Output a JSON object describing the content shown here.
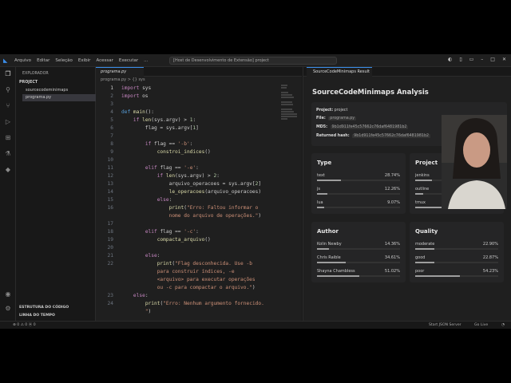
{
  "titlebar": {
    "menus": [
      "Arquivo",
      "Editar",
      "Seleção",
      "Exibir",
      "Acessar",
      "Executar",
      "..."
    ],
    "command_center": "[Host de Desenvolvimento de Extensão] project"
  },
  "sidebar": {
    "title": "EXPLORADOR",
    "section": "PROJECT",
    "files": [
      {
        "name": "sourcecodeminimaps"
      },
      {
        "name": "programa.py"
      }
    ],
    "bottom_sections": [
      "ESTRUTURA DO CÓDIGO",
      "LINHA DO TEMPO"
    ]
  },
  "editor": {
    "tab_label": "programa.py",
    "breadcrumb": "programa.py > {} sys"
  },
  "panel": {
    "tab_label": "SourceCodeMinimaps Result",
    "title": "SourceCodeMinimaps Analysis",
    "info": {
      "project_label": "Project:",
      "project": "project",
      "file_label": "File:",
      "file": "programa.py",
      "md5_label": "MD5:",
      "md5": "9b1d911fe45c57662c76daf6481981b2",
      "returned_label": "Returned hash:",
      "returned": "9b1d911fe45c57662c76daf6481981b2"
    },
    "cards": [
      {
        "title": "Type",
        "items": [
          {
            "name": "text",
            "pct": "28.74%",
            "value": 28.74
          },
          {
            "name": "js",
            "pct": "12.26%",
            "value": 12.26
          },
          {
            "name": "lua",
            "pct": "9.07%",
            "value": 9.07
          }
        ]
      },
      {
        "title": "Project",
        "items": [
          {
            "name": "jenkins",
            "pct": "20.33%",
            "value": 20.33
          },
          {
            "name": "outline",
            "pct": "9.86%",
            "value": 9.86
          },
          {
            "name": "tmux",
            "pct": "69.80%",
            "value": 69.8
          }
        ]
      },
      {
        "title": "Author",
        "items": [
          {
            "name": "Kolin Newby",
            "pct": "14.36%",
            "value": 14.36
          },
          {
            "name": "Chris Raible",
            "pct": "34.61%",
            "value": 34.61
          },
          {
            "name": "Shayna Chambless",
            "pct": "51.02%",
            "value": 51.02
          }
        ]
      },
      {
        "title": "Quality",
        "items": [
          {
            "name": "moderate",
            "pct": "22.90%",
            "value": 22.9
          },
          {
            "name": "good",
            "pct": "22.87%",
            "value": 22.87
          },
          {
            "name": "poor",
            "pct": "54.23%",
            "value": 54.23
          }
        ]
      }
    ]
  },
  "status": {
    "left": "⊗ 0  ⚠ 0   ⦿ 0",
    "right1": "Start JSON Server",
    "right2": "Go Live"
  },
  "code_lines": [
    {
      "n": "1",
      "html": "<span class='k'>import</span> sys"
    },
    {
      "n": "2",
      "html": "<span class='k'>import</span> os"
    },
    {
      "n": "3",
      "html": ""
    },
    {
      "n": "4",
      "html": "<span class='kb'>def</span> <span class='f'>main</span>():"
    },
    {
      "n": "5",
      "html": "    <span class='k'>if</span> <span class='f'>len</span>(sys.argv) &gt; <span class='n'>1</span>:"
    },
    {
      "n": "6",
      "html": "        flag = sys.argv[<span class='n'>1</span>]"
    },
    {
      "n": "7",
      "html": ""
    },
    {
      "n": "8",
      "html": "        <span class='k'>if</span> flag == <span class='s'>'-b'</span>:"
    },
    {
      "n": "9",
      "html": "            <span class='f'>constroi_indices</span>()"
    },
    {
      "n": "10",
      "html": ""
    },
    {
      "n": "11",
      "html": "        <span class='k'>elif</span> flag == <span class='s'>'-e'</span>:"
    },
    {
      "n": "12",
      "html": "            <span class='k'>if</span> <span class='f'>len</span>(sys.argv) &gt; <span class='n'>2</span>:"
    },
    {
      "n": "13",
      "html": "                arquivo_operacoes = sys.argv[<span class='n'>2</span>]"
    },
    {
      "n": "14",
      "html": "                <span class='f'>le_operacoes</span>(arquivo_operacoes)"
    },
    {
      "n": "15",
      "html": "            <span class='k'>else</span>:"
    },
    {
      "n": "16",
      "html": "                <span class='f'>print</span>(<span class='s'>\"Erro: Faltou informar o</span>"
    },
    {
      "n": "",
      "html": "                <span class='s'>nome do arquivo de operações.\"</span>)"
    },
    {
      "n": "17",
      "html": ""
    },
    {
      "n": "18",
      "html": "        <span class='k'>elif</span> flag == <span class='s'>'-c'</span>:"
    },
    {
      "n": "19",
      "html": "            <span class='f'>compacta_arquivo</span>()"
    },
    {
      "n": "20",
      "html": ""
    },
    {
      "n": "21",
      "html": "        <span class='k'>else</span>:"
    },
    {
      "n": "22",
      "html": "            <span class='f'>print</span>(<span class='s'>\"Flag desconhecida. Use -b</span>"
    },
    {
      "n": "",
      "html": "            <span class='s'>para construir índices, -e</span>"
    },
    {
      "n": "",
      "html": "            <span class='s'>&lt;arquivo&gt; para executar operações</span>"
    },
    {
      "n": "",
      "html": "            <span class='s'>ou -c para compactar o arquivo.\"</span>)"
    },
    {
      "n": "23",
      "html": "    <span class='k'>else</span>:"
    },
    {
      "n": "24",
      "html": "        <span class='f'>print</span>(<span class='s'>\"Erro: Nenhum argumento fornecido.</span>"
    },
    {
      "n": "",
      "html": "        <span class='s'>\"</span>)"
    }
  ]
}
